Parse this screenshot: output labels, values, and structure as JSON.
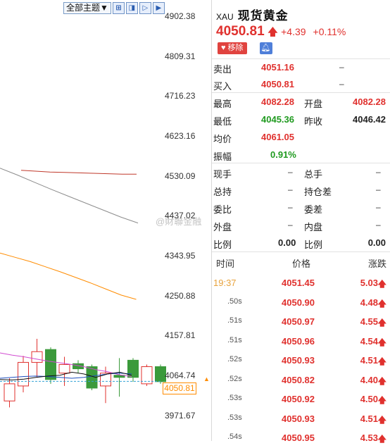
{
  "toolbar": {
    "theme_label": "全部主题▼",
    "buttons": [
      "plus-grid-icon",
      "expand-icon",
      "step-icon",
      "step-right-icon"
    ]
  },
  "chart_data": {
    "type": "candlestick",
    "y_ticks": [
      "4902.38",
      "4809.31",
      "4716.23",
      "4623.16",
      "4530.09",
      "4437.02",
      "4343.95",
      "4250.88",
      "4157.81",
      "4064.74",
      "3971.67"
    ],
    "ylim": [
      3948.4,
      4925.65
    ],
    "current_price_tag": "4050.81",
    "current_price": 4050.81,
    "colors": {
      "up": "#e0312e",
      "down": "#3b9a3b",
      "ma_long": "#8c8c8c",
      "ma_mid": "#c0392b",
      "ma_orange": "#ff8c00",
      "ma_magenta": "#d14bd1",
      "ma_black": "#111111",
      "ma_blue": "#1f4fbf",
      "current_line": "#33a3d6"
    },
    "candles": [
      {
        "o": 4005,
        "h": 4058,
        "l": 3990,
        "c": 4045
      },
      {
        "o": 4040,
        "h": 4110,
        "l": 4025,
        "c": 4095
      },
      {
        "o": 4095,
        "h": 4150,
        "l": 4060,
        "c": 4120
      },
      {
        "o": 4125,
        "h": 4130,
        "l": 4045,
        "c": 4055
      },
      {
        "o": 4070,
        "h": 4108,
        "l": 4040,
        "c": 4090
      },
      {
        "o": 4092,
        "h": 4100,
        "l": 4070,
        "c": 4080
      },
      {
        "o": 4085,
        "h": 4090,
        "l": 4030,
        "c": 4035
      },
      {
        "o": 4040,
        "h": 4085,
        "l": 4000,
        "c": 4070
      },
      {
        "o": 4065,
        "h": 4105,
        "l": 4015,
        "c": 4060
      },
      {
        "o": 4100,
        "h": 4105,
        "l": 4050,
        "c": 4060
      },
      {
        "o": 4045,
        "h": 4090,
        "l": 4040,
        "c": 4085
      },
      {
        "o": 4085,
        "h": 4090,
        "l": 4045,
        "c": 4050
      }
    ],
    "ma_long": [
      4548,
      4532,
      4515,
      4498,
      4482,
      4466,
      4450,
      4434,
      4420
    ],
    "ma_mid": [
      4543,
      4541,
      4539,
      4538,
      4537,
      4536,
      4535,
      4534,
      4534
    ],
    "ma_orange": [
      4350,
      4340,
      4330,
      4318,
      4306,
      4293,
      4280,
      4266,
      4252,
      4242
    ],
    "ma_magenta": [
      4117,
      4112,
      4108,
      4103,
      4098,
      4094,
      4090,
      4085,
      4078,
      4073,
      4066,
      4062
    ],
    "ma_black": [
      4055,
      4054,
      4056,
      4060,
      4063,
      4065,
      4072,
      4068,
      4060,
      4068,
      4072,
      4065
    ],
    "ma_blue": [
      4058,
      4060,
      4062,
      4063,
      4062,
      4060,
      4058,
      4060,
      4064,
      4068,
      4070,
      4068
    ]
  },
  "quote": {
    "symbol": "XAU",
    "name": "现货黄金",
    "last": "4050.81",
    "change": "+4.39",
    "change_pct": "+0.11%",
    "remove_label": "移除",
    "rows": {
      "sell_label": "卖出",
      "sell": "4051.16",
      "sell_vol": "–",
      "buy_label": "买入",
      "buy": "4050.81",
      "buy_vol": "–",
      "high_label": "最高",
      "high": "4082.28",
      "open_label": "开盘",
      "open": "4082.28",
      "low_label": "最低",
      "low": "4045.36",
      "prev_label": "昨收",
      "prev": "4046.42",
      "avg_label": "均价",
      "avg": "4061.05",
      "amp_label": "振幅",
      "amp": "0.91%",
      "now_hand_label": "现手",
      "now_hand": "–",
      "total_hand_label": "总手",
      "total_hand": "–",
      "hold_label": "总持",
      "hold": "–",
      "hold_diff_label": "持仓差",
      "hold_diff": "–",
      "wb_label": "委比",
      "wb": "–",
      "wc_label": "委差",
      "wc": "–",
      "outer_label": "外盘",
      "outer": "–",
      "inner_label": "内盘",
      "inner": "–",
      "ratio1_label": "比例",
      "ratio1": "0.00",
      "ratio2_label": "比例",
      "ratio2": "0.00"
    }
  },
  "ticks": {
    "headers": {
      "time": "时间",
      "price": "价格",
      "change": "涨跌"
    },
    "rows": [
      {
        "time": "19:37",
        "price": "4051.45",
        "change": "5.03"
      },
      {
        "time": ".50s",
        "price": "4050.90",
        "change": "4.48"
      },
      {
        "time": ".51s",
        "price": "4050.97",
        "change": "4.55"
      },
      {
        "time": ".51s",
        "price": "4050.96",
        "change": "4.54"
      },
      {
        "time": ".52s",
        "price": "4050.93",
        "change": "4.51"
      },
      {
        "time": ".52s",
        "price": "4050.82",
        "change": "4.40"
      },
      {
        "time": ".53s",
        "price": "4050.92",
        "change": "4.50"
      },
      {
        "time": ".53s",
        "price": "4050.93",
        "change": "4.51"
      },
      {
        "time": ".54s",
        "price": "4050.95",
        "change": "4.53"
      }
    ]
  },
  "watermark": "@財聯金融"
}
